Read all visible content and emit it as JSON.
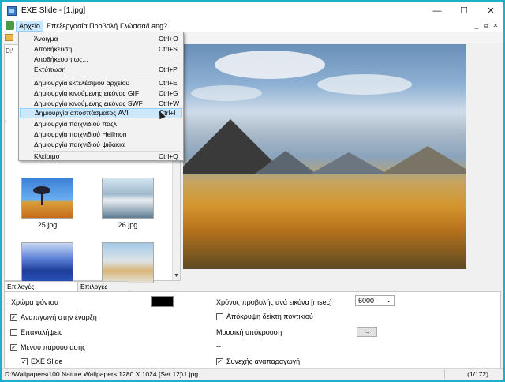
{
  "window": {
    "title": "EXE Slide - [1.jpg]"
  },
  "window_controls": {
    "minimize": "—",
    "maximize": "☐",
    "close": "✕"
  },
  "menubar": {
    "items": [
      "Αρχείο",
      "Επεξεργασία",
      "Προβολή",
      "Γλώσσα/Lang",
      "?"
    ],
    "mdi_controls": [
      "_",
      "⧉",
      "✕"
    ]
  },
  "left_panel": {
    "path_fragment": "D:\\",
    "thumbnails": [
      {
        "label": "25.jpg"
      },
      {
        "label": "26.jpg"
      },
      {
        "label": "",
        "note_icon": "thumbnail"
      },
      {
        "label": ""
      }
    ]
  },
  "file_menu": {
    "items": [
      {
        "label": "Άνοιγμα",
        "shortcut": "Ctrl+O"
      },
      {
        "label": "Αποθήκευση",
        "shortcut": "Ctrl+S"
      },
      {
        "label": "Αποθήκευση ως...",
        "shortcut": ""
      },
      {
        "label": "Εκτύπωση",
        "shortcut": "Ctrl+P"
      },
      {
        "label": "Δημιουργία εκτελέσιμου αρχείου",
        "shortcut": "Ctrl+E"
      },
      {
        "label": "Δημιουργία κινούμενης εικόνας GIF",
        "shortcut": "Ctrl+G"
      },
      {
        "label": "Δημιουργία κινούμενης εικόνας SWF",
        "shortcut": "Ctrl+W"
      },
      {
        "label": "Δημιουργία αποσπάσματος AVI",
        "shortcut": "Ctrl+I"
      },
      {
        "label": "Δημιουργία παιχνιδιού παζλ",
        "shortcut": ""
      },
      {
        "label": "Δημιουργία παιχνιδιού Heilmon",
        "shortcut": ""
      },
      {
        "label": "Δημιουργία παιχνιδιού ψιδάκια",
        "shortcut": ""
      },
      {
        "label": "Κλείσιμο",
        "shortcut": "Ctrl+Q"
      }
    ],
    "highlighted_index": 7
  },
  "tabs": [
    "Επιλογές παρουσίασης",
    "Επιλογές εικόνας"
  ],
  "options": {
    "background_color_label": "Χρώμα φόντου",
    "background_color": "#000000",
    "autoplay_label": "Αναπ/γωγή στην έναρξη",
    "repeat_label": "Επαναλήψεις",
    "presentation_menu_label": "Μενού παρουσίασης",
    "exe_slide_label": "EXE Slide",
    "view_time_label": "Χρόνος προβολής ανά εικόνα [msec]",
    "view_time_value": "6000",
    "hide_pointer_label": "Απόκρυψη δείκτη ποντικιού",
    "music_label": "Μουσική υπόκρουση",
    "music_button": "...",
    "music_value": "--",
    "continuous_label": "Συνεχής αναπαραγωγή"
  },
  "checkbox_states": {
    "autoplay": true,
    "repeat": false,
    "presentation_menu": true,
    "exe_slide": true,
    "hide_pointer": false,
    "continuous": true
  },
  "status": {
    "path": "D:\\Wallpapers\\100 Nature Wallpapers 1280 X 1024 [Set 12]\\1.jpg",
    "count": "(1/172)"
  },
  "colors": {
    "desktop": "#1ab1c9",
    "highlight": "#cce8ff",
    "highlight_border": "#99d1ff"
  }
}
